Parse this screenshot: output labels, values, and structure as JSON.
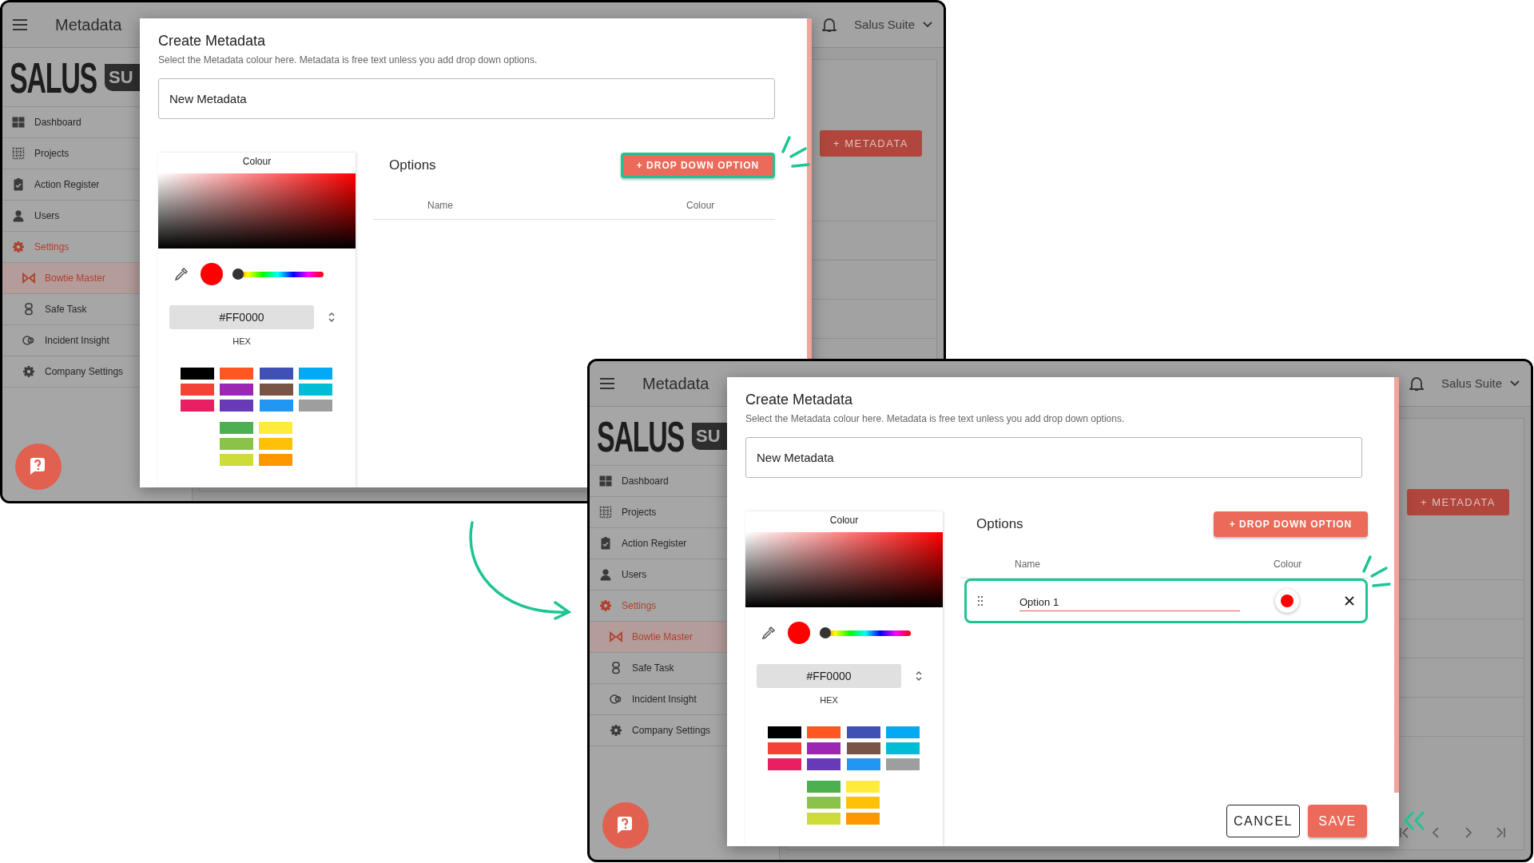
{
  "screens": [
    {
      "top_bar": {
        "title": "Metadata",
        "account": "Salus Suite"
      },
      "logo": {
        "wordmark": "SALUS",
        "tag": "SU"
      },
      "sidebar": {
        "items": [
          {
            "label": "Dashboard",
            "kind": "dashboard",
            "selected": false
          },
          {
            "label": "Projects",
            "kind": "projects",
            "selected": false
          },
          {
            "label": "Action Register",
            "kind": "register",
            "selected": false
          },
          {
            "label": "Users",
            "kind": "users",
            "selected": false
          },
          {
            "label": "Settings",
            "kind": "settings",
            "selected": false,
            "expanded": true,
            "children": [
              {
                "label": "Bowtie Master",
                "kind": "bowtie",
                "selected": true
              },
              {
                "label": "Safe Task",
                "kind": "safetask",
                "selected": false
              },
              {
                "label": "Incident Insight",
                "kind": "insight",
                "selected": false
              },
              {
                "label": "Company Settings",
                "kind": "company",
                "selected": false
              }
            ]
          }
        ]
      },
      "page": {
        "add_button": "+ METADATA"
      },
      "dialog": {
        "title": "Create Metadata",
        "subtitle": "Select the Metadata colour here. Metadata is free text unless you add drop down options.",
        "name_field": "New Metadata",
        "colour": {
          "label": "Colour",
          "color": "#ff0000",
          "hue": {
            "level": 0
          },
          "hex": "#FF0000",
          "hex_label": "HEX",
          "swatches": [
            {
              "color": "#000000"
            },
            {
              "color": "#ff5722"
            },
            {
              "color": "#3f51b5"
            },
            {
              "color": "#03a9f4"
            },
            {
              "color": "#f44336"
            },
            {
              "color": "#9c27b0"
            },
            {
              "color": "#795548"
            },
            {
              "color": "#00bcd4"
            },
            {
              "color": "#e91e63"
            },
            {
              "color": "#673ab7"
            },
            {
              "color": "#2196f3"
            },
            {
              "color": "#9e9e9e"
            }
          ],
          "extra_swatches": [
            {
              "color": "#4caf50"
            },
            {
              "color": "#ffeb3b"
            },
            {
              "color": "#8bc34a"
            },
            {
              "color": "#ffc107"
            },
            {
              "color": "#cddc39"
            },
            {
              "color": "#ff9800"
            }
          ]
        },
        "options": {
          "title": "Options",
          "add_button": {
            "label": "+ DROP DOWN OPTION",
            "highlighted": true
          },
          "columns": [
            "Name",
            "Colour"
          ]
        }
      }
    },
    {
      "top_bar": {
        "title": "Metadata",
        "account": "Salus Suite"
      },
      "logo": {
        "wordmark": "SALUS",
        "tag": "SU"
      },
      "sidebar": {
        "items": [
          {
            "label": "Dashboard",
            "kind": "dashboard",
            "selected": false
          },
          {
            "label": "Projects",
            "kind": "projects",
            "selected": false
          },
          {
            "label": "Action Register",
            "kind": "register",
            "selected": false
          },
          {
            "label": "Users",
            "kind": "users",
            "selected": false
          },
          {
            "label": "Settings",
            "kind": "settings",
            "selected": false,
            "expanded": true,
            "children": [
              {
                "label": "Bowtie Master",
                "kind": "bowtie",
                "selected": true
              },
              {
                "label": "Safe Task",
                "kind": "safetask",
                "selected": false
              },
              {
                "label": "Incident Insight",
                "kind": "insight",
                "selected": false
              },
              {
                "label": "Company Settings",
                "kind": "company",
                "selected": false
              }
            ]
          }
        ]
      },
      "page": {
        "add_button": "+ METADATA",
        "pagination": true
      },
      "dialog": {
        "title": "Create Metadata",
        "subtitle": "Select the Metadata colour here. Metadata is free text unless you add drop down options.",
        "name_field": "New Metadata",
        "colour": {
          "label": "Colour",
          "color": "#ff0000",
          "hue": {
            "level": 0
          },
          "hex": "#FF0000",
          "hex_label": "HEX",
          "swatches": [
            {
              "color": "#000000"
            },
            {
              "color": "#ff5722"
            },
            {
              "color": "#3f51b5"
            },
            {
              "color": "#03a9f4"
            },
            {
              "color": "#f44336"
            },
            {
              "color": "#9c27b0"
            },
            {
              "color": "#795548"
            },
            {
              "color": "#00bcd4"
            },
            {
              "color": "#e91e63"
            },
            {
              "color": "#673ab7"
            },
            {
              "color": "#2196f3"
            },
            {
              "color": "#9e9e9e"
            }
          ],
          "extra_swatches": [
            {
              "color": "#4caf50"
            },
            {
              "color": "#ffeb3b"
            },
            {
              "color": "#8bc34a"
            },
            {
              "color": "#ffc107"
            },
            {
              "color": "#cddc39"
            },
            {
              "color": "#ff9800"
            }
          ]
        },
        "options": {
          "title": "Options",
          "add_button": {
            "label": "+ DROP DOWN OPTION",
            "highlighted": false
          },
          "columns": [
            "Name",
            "Colour"
          ],
          "rows": [
            {
              "name": "Option 1",
              "color": "#ff0000",
              "highlighted": true
            }
          ]
        },
        "actions": [
          "CANCEL",
          "SAVE"
        ]
      }
    }
  ]
}
